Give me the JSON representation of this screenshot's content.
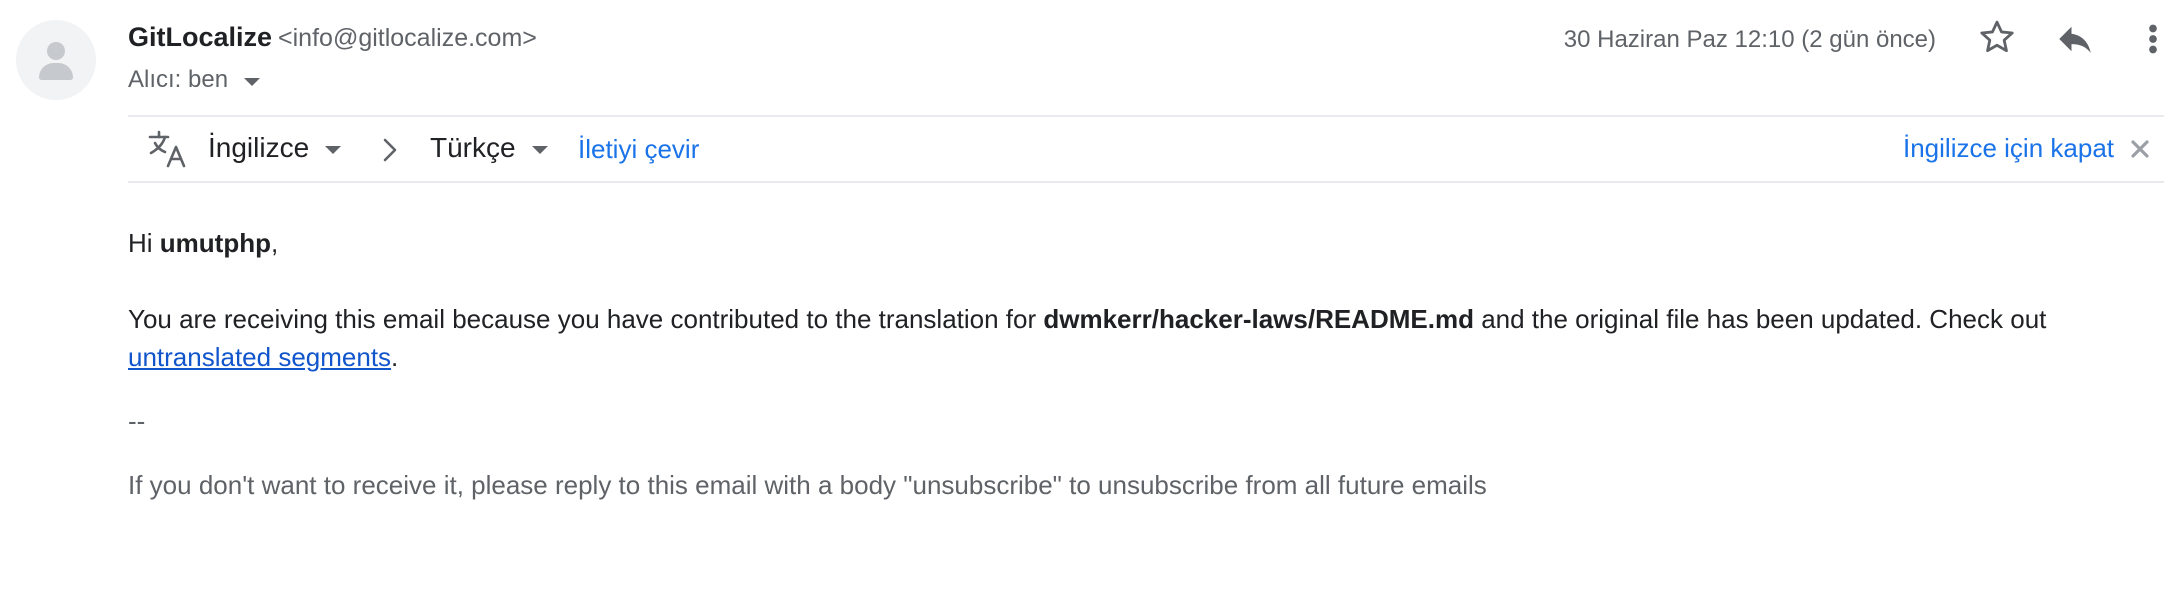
{
  "email": {
    "sender_name": "GitLocalize",
    "sender_email": "<info@gitlocalize.com>",
    "recipient_label": "Alıcı: ben",
    "date": "30 Haziran Paz 12:10 (2 gün önce)"
  },
  "icons": {
    "avatar": "person-avatar-icon",
    "star": "star-icon",
    "reply": "reply-icon",
    "more": "more-vert-icon",
    "translate": "translate-icon",
    "chevron": "chevron-right-icon",
    "close": "close-icon"
  },
  "translate_bar": {
    "source_language": "İngilizce",
    "target_language": "Türkçe",
    "translate_link": "İletiyi çevir",
    "turn_off_link": "İngilizce için kapat"
  },
  "body": {
    "greeting_prefix": "Hi ",
    "greeting_name": "umutphp",
    "greeting_suffix": ",",
    "line1_before": "You are receiving this email because you have contributed to the translation for ",
    "line1_bold": "dwmkerr/hacker-laws/README.md",
    "line1_after": " and the original file has been updated. Check out ",
    "link_text": "untranslated segments",
    "line1_end": ".",
    "separator": "--",
    "footer": "If you don't want to receive it, please reply to this email with a body \"unsubscribe\" to unsubscribe from all future emails"
  },
  "colors": {
    "link": "#1155cc",
    "translate_link": "#1a73e8",
    "secondary_text": "#5f6368"
  }
}
